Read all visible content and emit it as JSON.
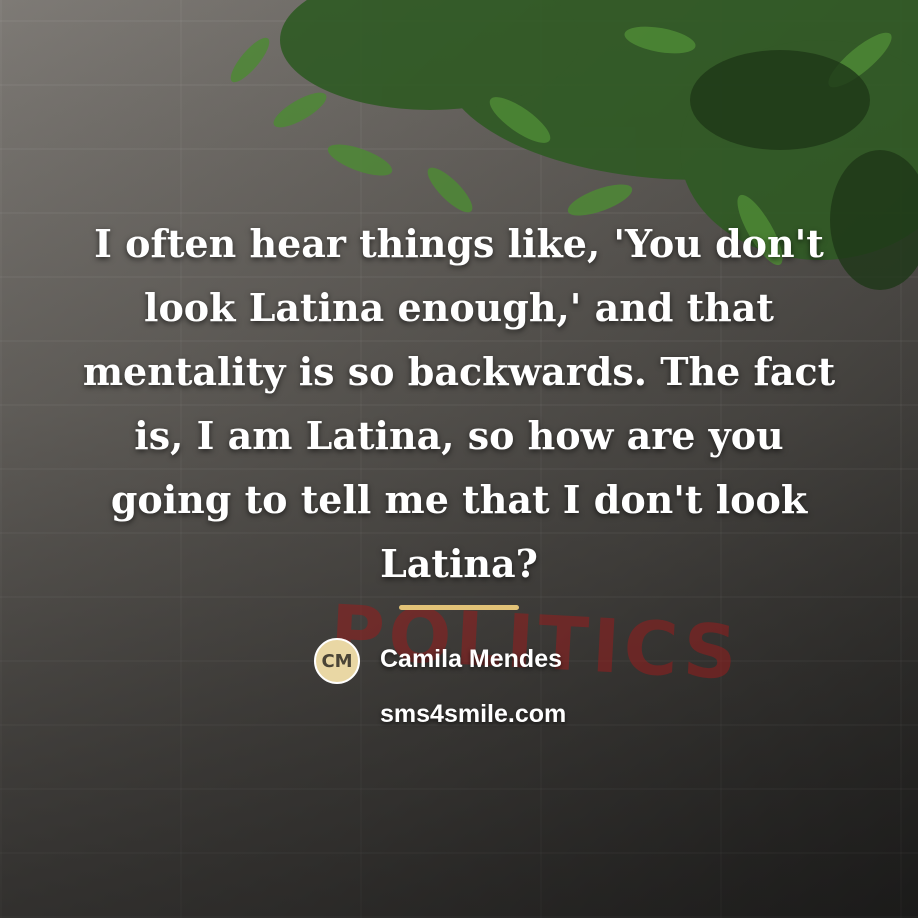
{
  "quote": {
    "text": "I often hear things like, 'You don't look Latina enough,' and that mentality is so backwards. The fact is, I am Latina, so how are you going to tell me that I don't look Latina?",
    "author": "Camila Mendes",
    "author_initials": "CM"
  },
  "site": "sms4smile.com",
  "background": {
    "graffiti_text": "POLITICS",
    "accent_color": "#e2c277",
    "wall_color": "#6e6a65",
    "foliage_color": "#2f5a23"
  }
}
